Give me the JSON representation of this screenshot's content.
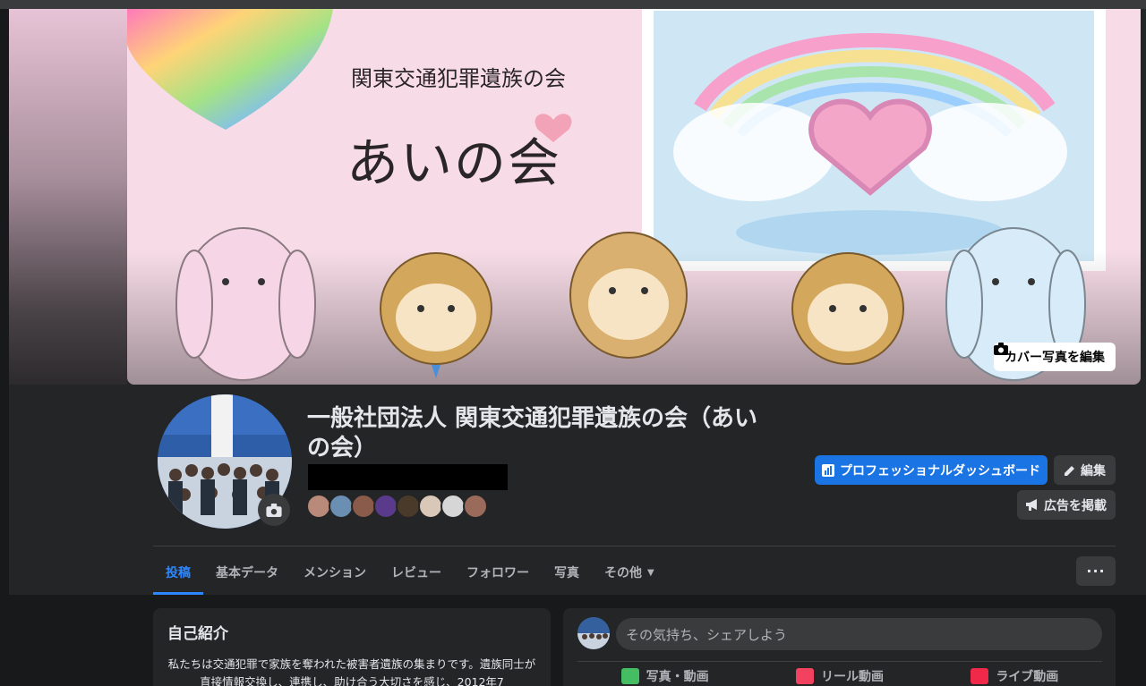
{
  "cover": {
    "org_text": "関東交通犯罪遺族の会",
    "name_text": "あいの会",
    "edit_label": "カバー写真を編集",
    "edit_icon": "camera-icon"
  },
  "profile": {
    "name": "一般社団法人 関東交通犯罪遺族の会（あいの会）",
    "avatar_camera_icon": "camera-icon"
  },
  "actions": {
    "dashboard_label": "プロフェッショナルダッシュボード",
    "edit_label": "編集",
    "ad_label": "広告を掲載"
  },
  "tabs": [
    {
      "label": "投稿",
      "active": true
    },
    {
      "label": "基本データ"
    },
    {
      "label": "メンション"
    },
    {
      "label": "レビュー"
    },
    {
      "label": "フォロワー"
    },
    {
      "label": "写真"
    },
    {
      "label": "その他"
    }
  ],
  "more_label": "···",
  "intro": {
    "title": "自己紹介",
    "text": "私たちは交通犯罪で家族を奪われた被害者遺族の集まりです。遺族同士が直接情報交換し、連携し、助け合う大切さを感じ、2012年7"
  },
  "composer": {
    "placeholder": "その気持ち、シェアしよう",
    "actions": [
      {
        "label": "写真・動画",
        "color": "#45bd62"
      },
      {
        "label": "リール動画",
        "color": "#f3425f"
      },
      {
        "label": "ライブ動画",
        "color": "#f02849"
      }
    ]
  },
  "colors": {
    "accent": "#1b74e4",
    "active_tab": "#2d88ff",
    "surface": "#242526"
  }
}
